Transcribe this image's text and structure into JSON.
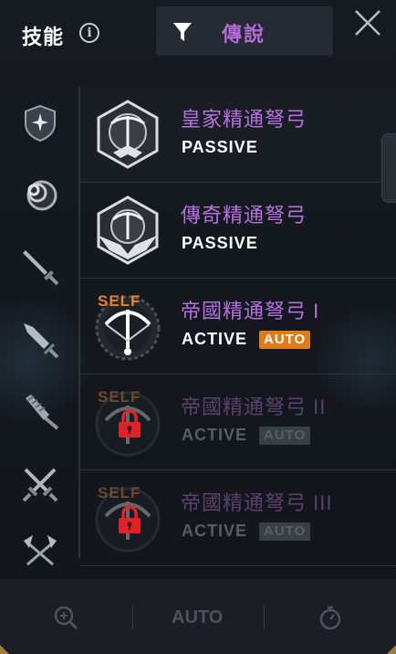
{
  "header": {
    "title": "技能",
    "info_icon": "info-icon",
    "filter_label": "傳說",
    "filter_icon": "filter-icon",
    "close_icon": "close-icon"
  },
  "sidebar": {
    "items": [
      {
        "icon": "shield-emblem-icon",
        "selected": true
      },
      {
        "icon": "triple-ring-icon",
        "selected": false
      },
      {
        "icon": "sword-icon",
        "selected": false
      },
      {
        "icon": "dagger-icon",
        "selected": false
      },
      {
        "icon": "mace-icon",
        "selected": false
      },
      {
        "icon": "crossed-swords-icon",
        "selected": false
      },
      {
        "icon": "crossed-axes-icon",
        "selected": false
      }
    ]
  },
  "skills": [
    {
      "name": "皇家精通弩弓",
      "type": "PASSIVE",
      "auto": null,
      "self": null,
      "locked": false
    },
    {
      "name": "傳奇精通弩弓",
      "type": "PASSIVE",
      "auto": null,
      "self": null,
      "locked": false
    },
    {
      "name": "帝國精通弩弓 I",
      "type": "ACTIVE",
      "auto": "AUTO",
      "self": "SELF",
      "locked": false
    },
    {
      "name": "帝國精通弩弓 II",
      "type": "ACTIVE",
      "auto": "AUTO",
      "self": "SELF",
      "locked": true
    },
    {
      "name": "帝國精通弩弓 III",
      "type": "ACTIVE",
      "auto": "AUTO",
      "self": "SELF",
      "locked": true
    }
  ],
  "bottom_bar": {
    "zoom_icon": "zoom-in-icon",
    "auto_label": "AUTO",
    "timer_icon": "stopwatch-icon"
  },
  "colors": {
    "legend_purple": "#b56fe0",
    "auto_orange": "#e07b1a",
    "self_orange": "#e9802a",
    "lock_red": "#e0222a"
  }
}
